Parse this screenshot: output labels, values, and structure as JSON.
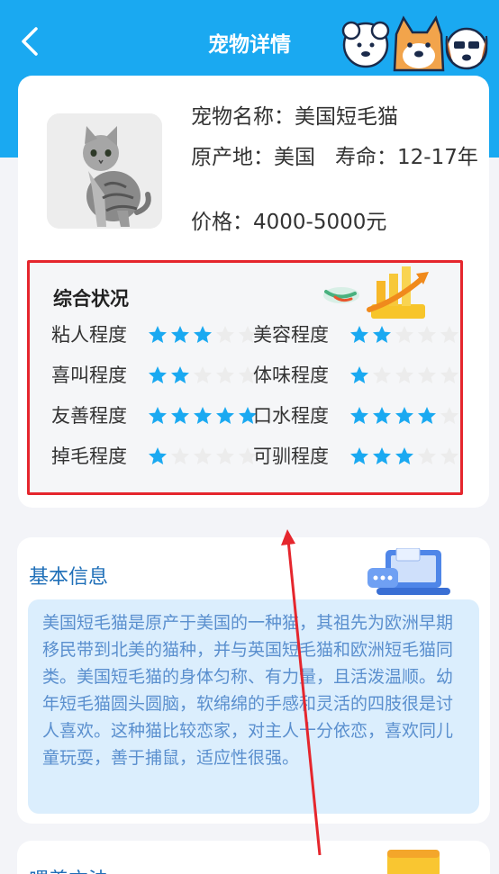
{
  "header": {
    "title": "宠物详情"
  },
  "pet": {
    "name_line": "宠物名称：美国短毛猫",
    "origin": "原产地：美国",
    "lifespan": "寿命：12-17年",
    "price": "价格：4000-5000元"
  },
  "status": {
    "title": "综合状况",
    "items": [
      {
        "label": "粘人程度",
        "stars": 3
      },
      {
        "label": "美容程度",
        "stars": 2
      },
      {
        "label": "喜叫程度",
        "stars": 2
      },
      {
        "label": "体味程度",
        "stars": 1
      },
      {
        "label": "友善程度",
        "stars": 5
      },
      {
        "label": "口水程度",
        "stars": 4
      },
      {
        "label": "掉毛程度",
        "stars": 1
      },
      {
        "label": "可驯程度",
        "stars": 3
      }
    ],
    "max_stars": 5,
    "star_color": "#1aa9f1"
  },
  "basic": {
    "title": "基本信息",
    "description": "美国短毛猫是原产于美国的一种猫，其祖先为欧洲早期移民带到北美的猫种，并与英国短毛猫和欧洲短毛猫同类。美国短毛猫的身体匀称、有力量，且活泼温顺。幼年短毛猫圆头圆脑，软绵绵的手感和灵活的四肢很是讨人喜欢。这种猫比较恋家，对主人十分依恋，喜欢同儿童玩耍，善于捕鼠，适应性很强。"
  },
  "feeding": {
    "title": "喂养方法"
  },
  "colors": {
    "primary": "#1aa9f1",
    "highlight": "#e5262d"
  }
}
